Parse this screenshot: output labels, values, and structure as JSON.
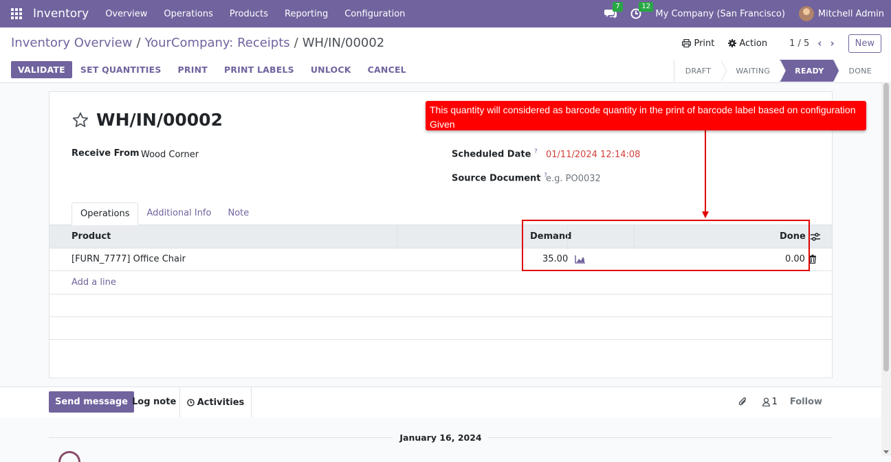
{
  "navbar": {
    "brand": "Inventory",
    "menu": [
      "Overview",
      "Operations",
      "Products",
      "Reporting",
      "Configuration"
    ],
    "messages_count": "7",
    "activities_count": "12",
    "company": "My Company (San Francisco)",
    "user": "Mitchell Admin"
  },
  "breadcrumb": {
    "items": [
      "Inventory Overview",
      "YourCompany: Receipts"
    ],
    "current": "WH/IN/00002"
  },
  "control": {
    "print_label": "Print",
    "action_label": "Action",
    "pager": "1 / 5",
    "new_label": "New"
  },
  "actions": [
    "VALIDATE",
    "SET QUANTITIES",
    "PRINT",
    "PRINT LABELS",
    "UNLOCK",
    "CANCEL"
  ],
  "statusbar": [
    "DRAFT",
    "WAITING",
    "READY",
    "DONE"
  ],
  "record": {
    "name": "WH/IN/00002",
    "receive_from_label": "Receive From",
    "receive_from_value": "Wood Corner",
    "scheduled_date_label": "Scheduled Date",
    "scheduled_date_value": "01/11/2024 12:14:08",
    "source_document_label": "Source Document",
    "source_document_placeholder": "e.g. PO0032",
    "help_mark": "?"
  },
  "tabs": [
    "Operations",
    "Additional Info",
    "Note"
  ],
  "table": {
    "headers": {
      "product": "Product",
      "demand": "Demand",
      "done": "Done"
    },
    "rows": [
      {
        "product": "[FURN_7777] Office Chair",
        "demand": "35.00",
        "done": "0.00"
      }
    ],
    "add_line": "Add a line"
  },
  "chatter": {
    "send_message": "Send message",
    "log_note": "Log note",
    "activities": "Activities",
    "followers_count": "1",
    "follow": "Follow",
    "date": "January 16, 2024"
  },
  "annotation": {
    "text": "This quantity will considered as barcode quantity in the print of barcode label based on configuration Given"
  },
  "colors": {
    "brand": "#71639e",
    "annotation": "#ff0000",
    "date_red": "#d23f3a"
  }
}
